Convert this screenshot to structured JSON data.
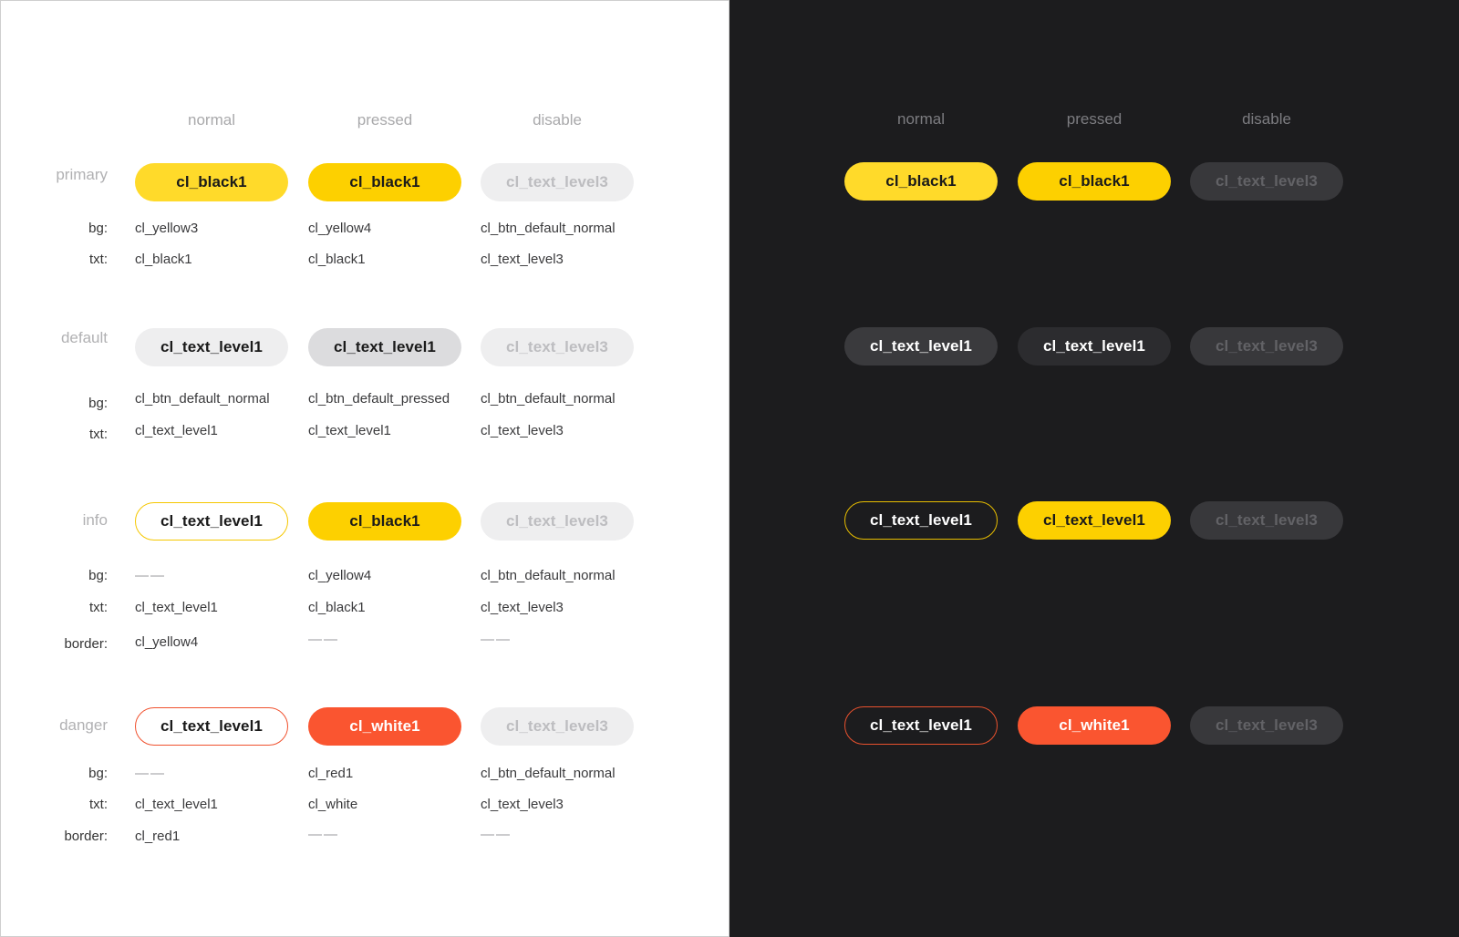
{
  "light": {
    "columns": [
      "normal",
      "pressed",
      "disable"
    ],
    "rows": [
      {
        "label": "primary",
        "buttons": [
          {
            "text": "cl_black1",
            "bg": "#FFDA2A",
            "color": "#1A1A1A",
            "border": "none"
          },
          {
            "text": "cl_black1",
            "bg": "#FDD000",
            "color": "#1A1A1A",
            "border": "none"
          },
          {
            "text": "cl_text_level3",
            "bg": "#EEEEEF",
            "color": "#BDBDC0",
            "border": "none"
          }
        ],
        "specs": [
          {
            "label": "bg:",
            "values": [
              "cl_yellow3",
              "cl_yellow4",
              "cl_btn_default_normal"
            ]
          },
          {
            "label": "txt:",
            "values": [
              "cl_black1",
              "cl_black1",
              "cl_text_level3"
            ]
          }
        ]
      },
      {
        "label": "default",
        "buttons": [
          {
            "text": "cl_text_level1",
            "bg": "#EEEEEF",
            "color": "#1A1A1A",
            "border": "none"
          },
          {
            "text": "cl_text_level1",
            "bg": "#DCDCDE",
            "color": "#1A1A1A",
            "border": "none"
          },
          {
            "text": "cl_text_level3",
            "bg": "#EEEEEF",
            "color": "#BDBDC0",
            "border": "none"
          }
        ],
        "specs": [
          {
            "label": "bg:",
            "values": [
              "cl_btn_default_normal",
              "cl_btn_default_pressed",
              "cl_btn_default_normal"
            ]
          },
          {
            "label": "txt:",
            "values": [
              "cl_text_level1",
              "cl_text_level1",
              "cl_text_level3"
            ]
          }
        ]
      },
      {
        "label": "info",
        "buttons": [
          {
            "text": "cl_text_level1",
            "bg": "#FFFFFF",
            "color": "#1A1A1A",
            "border": "1.5px solid #F5C700"
          },
          {
            "text": "cl_black1",
            "bg": "#FDD000",
            "color": "#1A1A1A",
            "border": "none"
          },
          {
            "text": "cl_text_level3",
            "bg": "#EEEEEF",
            "color": "#BDBDC0",
            "border": "none"
          }
        ],
        "specs": [
          {
            "label": "bg:",
            "values": [
              "——",
              "cl_yellow4",
              "cl_btn_default_normal"
            ]
          },
          {
            "label": "txt:",
            "values": [
              "cl_text_level1",
              "cl_black1",
              "cl_text_level3"
            ]
          },
          {
            "label": "border:",
            "values": [
              "cl_yellow4",
              "——",
              "——"
            ]
          }
        ]
      },
      {
        "label": "danger",
        "buttons": [
          {
            "text": "cl_text_level1",
            "bg": "#FFFFFF",
            "color": "#1A1A1A",
            "border": "1.5px solid #F0512E"
          },
          {
            "text": "cl_white1",
            "bg": "#FA5530",
            "color": "#FFFFFF",
            "border": "none"
          },
          {
            "text": "cl_text_level3",
            "bg": "#EEEEEF",
            "color": "#BDBDC0",
            "border": "none"
          }
        ],
        "specs": [
          {
            "label": "bg:",
            "values": [
              "——",
              "cl_red1",
              "cl_btn_default_normal"
            ]
          },
          {
            "label": "txt:",
            "values": [
              "cl_text_level1",
              "cl_white",
              "cl_text_level3"
            ]
          },
          {
            "label": "border:",
            "values": [
              "cl_red1",
              "——",
              "——"
            ]
          }
        ]
      }
    ]
  },
  "dark": {
    "columns": [
      "normal",
      "pressed",
      "disable"
    ],
    "rows": [
      {
        "buttons": [
          {
            "text": "cl_black1",
            "bg": "#FFDA2A",
            "color": "#1A1A1A",
            "border": "none"
          },
          {
            "text": "cl_black1",
            "bg": "#FDD000",
            "color": "#1A1A1A",
            "border": "none"
          },
          {
            "text": "cl_text_level3",
            "bg": "#38383B",
            "color": "#626266",
            "border": "none"
          }
        ]
      },
      {
        "buttons": [
          {
            "text": "cl_text_level1",
            "bg": "#3A3A3D",
            "color": "#FFFFFF",
            "border": "none"
          },
          {
            "text": "cl_text_level1",
            "bg": "#2C2C2F",
            "color": "#FFFFFF",
            "border": "none"
          },
          {
            "text": "cl_text_level3",
            "bg": "#38383B",
            "color": "#626266",
            "border": "none"
          }
        ]
      },
      {
        "buttons": [
          {
            "text": "cl_text_level1",
            "bg": "#1C1C1E",
            "color": "#FFFFFF",
            "border": "1.5px solid #E8BE00"
          },
          {
            "text": "cl_text_level1",
            "bg": "#FDD000",
            "color": "#1A1A1A",
            "border": "none"
          },
          {
            "text": "cl_text_level3",
            "bg": "#38383B",
            "color": "#626266",
            "border": "none"
          }
        ]
      },
      {
        "buttons": [
          {
            "text": "cl_text_level1",
            "bg": "#1C1C1E",
            "color": "#FFFFFF",
            "border": "1.5px solid #E8512E"
          },
          {
            "text": "cl_white1",
            "bg": "#FA5530",
            "color": "#FFFFFF",
            "border": "none"
          },
          {
            "text": "cl_text_level3",
            "bg": "#38383B",
            "color": "#626266",
            "border": "none"
          }
        ]
      }
    ]
  }
}
